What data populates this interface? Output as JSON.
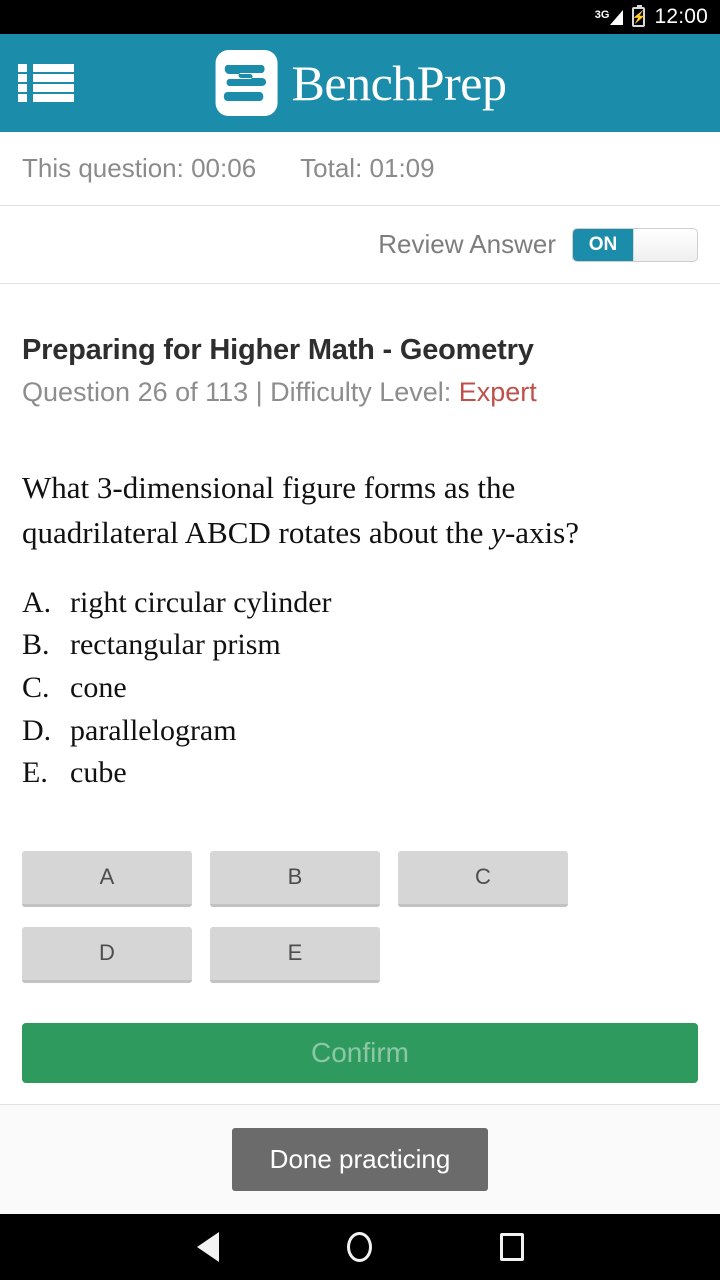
{
  "status_bar": {
    "network": "3G",
    "network_icon": "signal-bars-icon",
    "battery_icon": "battery-charging-icon",
    "time": "12:00"
  },
  "app_bar": {
    "menu_icon": "list-menu-icon",
    "logo_icon": "benchprep-logo-icon",
    "brand_name": "BenchPrep",
    "background_color": "#1b8ca9"
  },
  "timers": {
    "question_timer": "This question: 00:06",
    "total_timer": "Total: 01:09"
  },
  "review": {
    "label": "Review Answer",
    "toggle_state": "ON",
    "toggle_color": "#1b8ca9"
  },
  "question": {
    "title": "Preparing for Higher Math - Geometry",
    "meta_prefix": "Question 26 of 113 | Difficulty Level: ",
    "difficulty": "Expert",
    "difficulty_color": "#c0504a",
    "number": 26,
    "total": 113,
    "text_line_1": "What 3-dimensional figure forms as the",
    "text_line_2_pre": "quadrilateral ABCD rotates about the ",
    "text_line_2_italic": "y",
    "text_line_2_post": "-axis?",
    "choices": [
      {
        "letter": "A.",
        "text": "right circular cylinder"
      },
      {
        "letter": "B.",
        "text": "rectangular prism"
      },
      {
        "letter": "C.",
        "text": "cone"
      },
      {
        "letter": "D.",
        "text": "parallelogram"
      },
      {
        "letter": "E.",
        "text": "cube"
      }
    ]
  },
  "answer_buttons": [
    "A",
    "B",
    "C",
    "D",
    "E"
  ],
  "confirm": {
    "label": "Confirm",
    "color": "#2e9a5e",
    "enabled": false
  },
  "footer": {
    "done_label": "Done practicing",
    "color": "#6b6b6b"
  },
  "nav_bar": {
    "back_icon": "back-triangle-icon",
    "home_icon": "home-circle-icon",
    "recents_icon": "recents-square-icon"
  }
}
